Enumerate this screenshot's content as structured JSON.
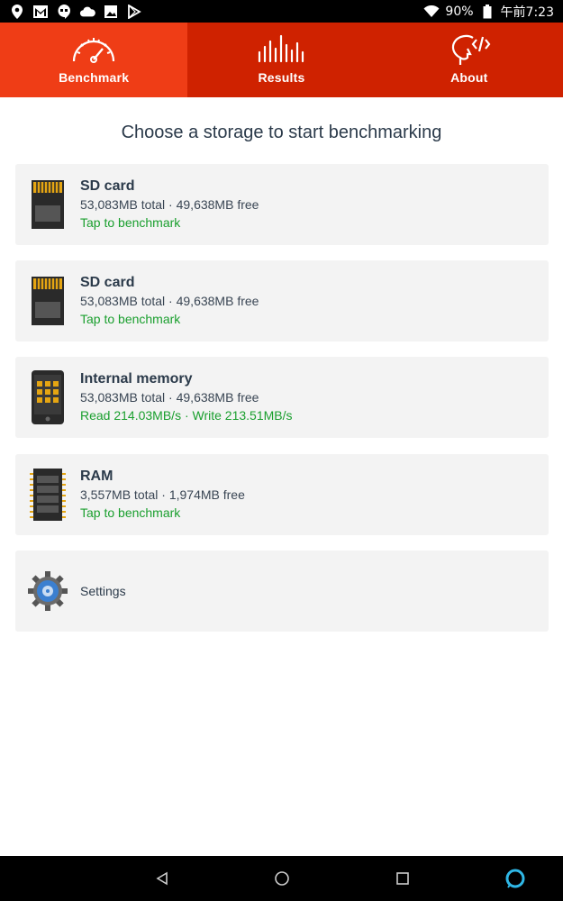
{
  "status_bar": {
    "battery": "90%",
    "time": "午前7:23",
    "icons_left": [
      "location-icon",
      "gmail-icon",
      "hangouts-icon",
      "cloud-icon",
      "image-icon",
      "play-store-icon"
    ],
    "icons_right": [
      "wifi-icon",
      "battery-icon"
    ]
  },
  "tabs": [
    {
      "label": "Benchmark",
      "icon": "speedometer-icon",
      "active": true
    },
    {
      "label": "Results",
      "icon": "bars-icon",
      "active": false
    },
    {
      "label": "About",
      "icon": "head-code-icon",
      "active": false
    }
  ],
  "heading": "Choose a storage to start benchmarking",
  "storages": [
    {
      "icon": "sd-card-icon",
      "title": "SD card",
      "detail": "53,083MB total · 49,638MB free",
      "action": "Tap to benchmark"
    },
    {
      "icon": "sd-card-icon",
      "title": "SD card",
      "detail": "53,083MB total · 49,638MB free",
      "action": "Tap to benchmark"
    },
    {
      "icon": "phone-icon",
      "title": "Internal memory",
      "detail": "53,083MB total · 49,638MB free",
      "action": "Read 214.03MB/s · Write 213.51MB/s"
    },
    {
      "icon": "ram-chip-icon",
      "title": "RAM",
      "detail": "3,557MB total · 1,974MB free",
      "action": "Tap to benchmark"
    }
  ],
  "settings": {
    "icon": "gear-icon",
    "label": "Settings"
  },
  "nav": {
    "buttons": [
      "back-icon",
      "home-icon",
      "recents-icon",
      "assistant-icon"
    ]
  },
  "colors": {
    "tab_bg": "#cf2200",
    "tab_active": "#ef3d16",
    "action_green": "#1a9f2e",
    "text_dark": "#2b3a4a"
  }
}
